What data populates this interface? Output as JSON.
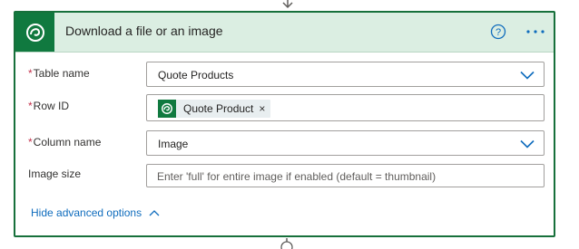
{
  "action_card": {
    "title": "Download a file or an image",
    "icons": {
      "logo": "dataverse-icon",
      "help": "help-circle-icon",
      "more": "more-horizontal-icon"
    }
  },
  "fields": {
    "table_name": {
      "label": "Table name",
      "required_marker": "*",
      "value": "Quote Products"
    },
    "row_id": {
      "label": "Row ID",
      "required_marker": "*",
      "token_label": "Quote Product",
      "token_remove": "×"
    },
    "column_name": {
      "label": "Column name",
      "required_marker": "*",
      "value": "Image"
    },
    "image_size": {
      "label": "Image size",
      "placeholder": "Enter 'full' for entire image if enabled (default = thumbnail)"
    }
  },
  "advanced": {
    "label": "Hide advanced options"
  },
  "colors": {
    "accent": "#10793f",
    "header_bg": "#dbeee2",
    "link": "#0f6cbd",
    "required": "#c4314b"
  }
}
